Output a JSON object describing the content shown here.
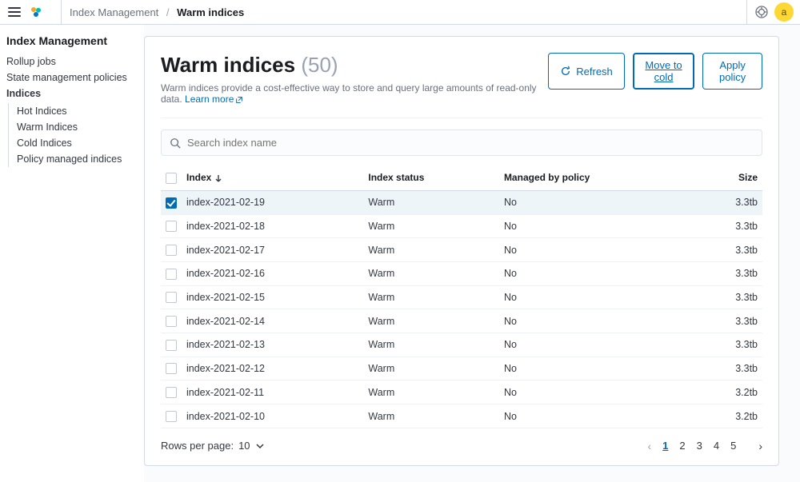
{
  "breadcrumb": {
    "parent": "Index Management",
    "current": "Warm indices"
  },
  "avatar_initial": "a",
  "sidebar": {
    "title": "Index Management",
    "items": [
      "Rollup jobs",
      "State management policies",
      "Indices"
    ],
    "sub_items": [
      "Hot Indices",
      "Warm Indices",
      "Cold Indices",
      "Policy managed indices"
    ]
  },
  "page": {
    "title": "Warm indices",
    "count": "(50)",
    "desc_prefix": "Warm indices provide a cost-effective way to store and query large amounts of read-only data. ",
    "learn_more": "Learn more"
  },
  "actions": {
    "refresh": "Refresh",
    "move_to_cold": "Move to cold",
    "apply_policy": "Apply policy"
  },
  "search": {
    "placeholder": "Search index name"
  },
  "columns": {
    "index": "Index",
    "status": "Index status",
    "managed": "Managed by policy",
    "size": "Size"
  },
  "rows": [
    {
      "name": "index-2021-02-19",
      "status": "Warm",
      "managed": "No",
      "size": "3.3tb",
      "checked": true
    },
    {
      "name": "index-2021-02-18",
      "status": "Warm",
      "managed": "No",
      "size": "3.3tb",
      "checked": false
    },
    {
      "name": "index-2021-02-17",
      "status": "Warm",
      "managed": "No",
      "size": "3.3tb",
      "checked": false
    },
    {
      "name": "index-2021-02-16",
      "status": "Warm",
      "managed": "No",
      "size": "3.3tb",
      "checked": false
    },
    {
      "name": "index-2021-02-15",
      "status": "Warm",
      "managed": "No",
      "size": "3.3tb",
      "checked": false
    },
    {
      "name": "index-2021-02-14",
      "status": "Warm",
      "managed": "No",
      "size": "3.3tb",
      "checked": false
    },
    {
      "name": "index-2021-02-13",
      "status": "Warm",
      "managed": "No",
      "size": "3.3tb",
      "checked": false
    },
    {
      "name": "index-2021-02-12",
      "status": "Warm",
      "managed": "No",
      "size": "3.3tb",
      "checked": false
    },
    {
      "name": "index-2021-02-11",
      "status": "Warm",
      "managed": "No",
      "size": "3.2tb",
      "checked": false
    },
    {
      "name": "index-2021-02-10",
      "status": "Warm",
      "managed": "No",
      "size": "3.2tb",
      "checked": false
    }
  ],
  "footer": {
    "rows_per_page_label": "Rows per page:",
    "rows_per_page_value": "10",
    "pages": [
      "1",
      "2",
      "3",
      "4",
      "5"
    ],
    "active_page": "1"
  }
}
